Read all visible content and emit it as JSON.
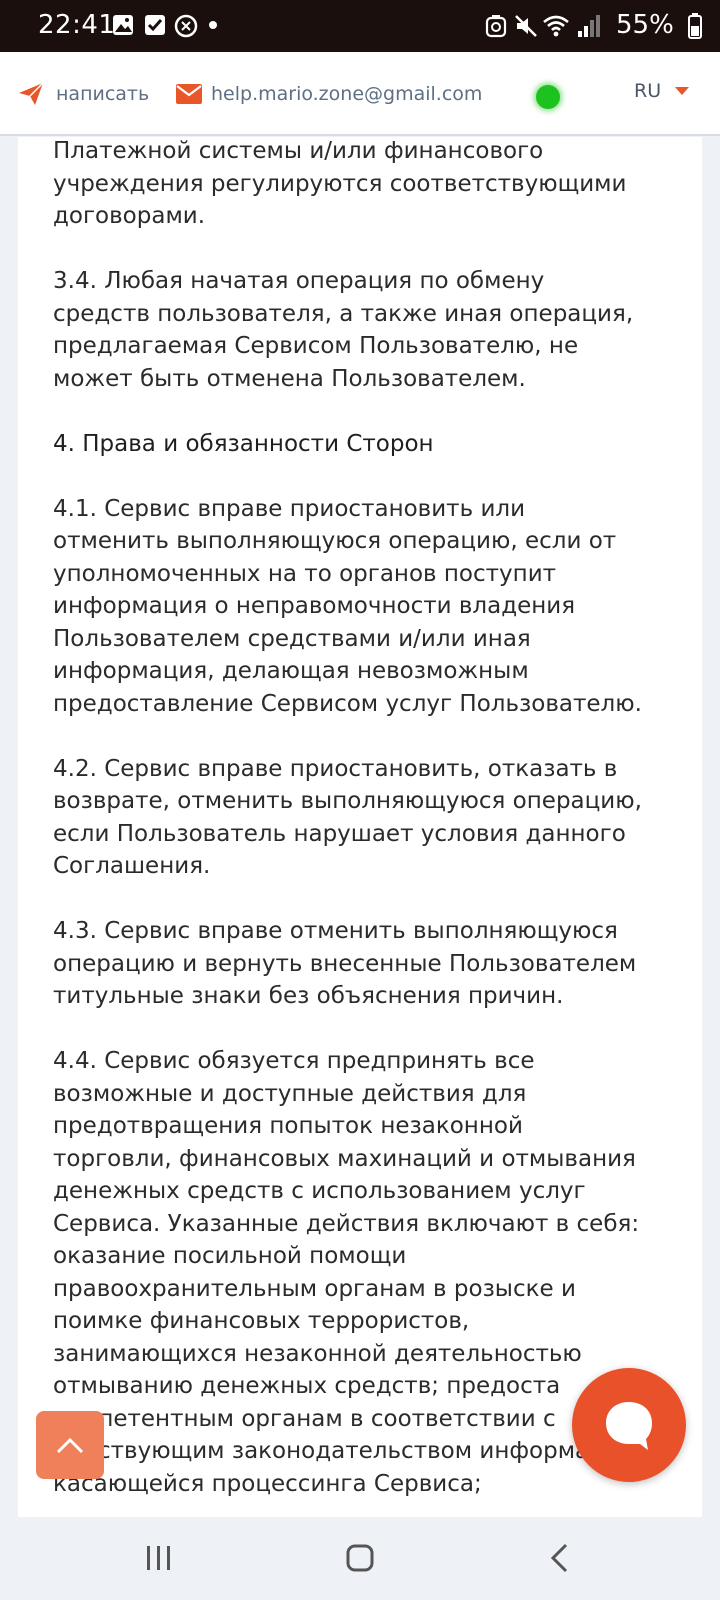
{
  "status_bar": {
    "time": "22:41",
    "battery": "55%",
    "left_icons": [
      "gallery-icon",
      "checkbox-icon",
      "threads-icon",
      "notification-dot-icon"
    ],
    "right_icons": [
      "data-saver-icon",
      "mute-icon",
      "wifi-icon",
      "signal-icon",
      "battery-icon"
    ]
  },
  "header": {
    "write_label": "написать",
    "email": "help.mario.zone@gmail.com",
    "language": "RU",
    "accent_color": "#e8562a",
    "online_color": "#1ec21e"
  },
  "content": {
    "paragraphs": [
      {
        "lines": [
          "Платежной системы и/или финансового",
          "учреждения регулируются соответствующими",
          "договорами."
        ]
      },
      {
        "lines": [
          "3.4. Любая начатая операция по обмену",
          "средств пользователя, а также иная операция,",
          "предлагаемая Сервисом Пользователю, не",
          "может быть отменена Пользователем."
        ]
      },
      {
        "heading": true,
        "lines": [
          "4. Права и обязанности Сторон"
        ]
      },
      {
        "lines": [
          "4.1. Сервис вправе приостановить или",
          "отменить выполняющуюся операцию, если от",
          "уполномоченных на то органов поступит",
          "информация о неправомочности владения",
          "Пользователем средствами и/или иная",
          "информация, делающая невозможным",
          "предоставление Сервисом услуг Пользователю."
        ]
      },
      {
        "lines": [
          "4.2. Сервис вправе приостановить, отказать в",
          "возврате, отменить выполняющуюся операцию,",
          "если Пользователь нарушает условия данного",
          "Соглашения."
        ]
      },
      {
        "lines": [
          "4.3. Сервис вправе отменить выполняющуюся",
          "операцию и вернуть внесенные Пользователем",
          "титульные знаки без объяснения причин."
        ]
      },
      {
        "lines": [
          "4.4. Сервис обязуется предпринять все",
          "возможные и доступные действия для",
          "предотвращения попыток незаконной",
          "торговли, финансовых махинаций и отмывания",
          "денежных средств с использованием услуг",
          "Сервиса. Указанные действия включают в себя:",
          "оказание посильной помощи",
          "правоохранительным органам в розыске и",
          "поимке финансовых террористов,",
          "занимающихся незаконной деятельностью",
          "отмыванию денежных средств; предоста",
          "компетентным органам в соответствии с",
          "действующим законодательством информации,",
          "касающейся процессинга Сервиса;"
        ]
      }
    ]
  },
  "floating": {
    "scroll_top_icon": "chevron-up-icon",
    "chat_icon": "chat-bubble-icon"
  },
  "nav_bar": {
    "icons": [
      "recent-apps-icon",
      "home-icon",
      "back-icon"
    ]
  }
}
